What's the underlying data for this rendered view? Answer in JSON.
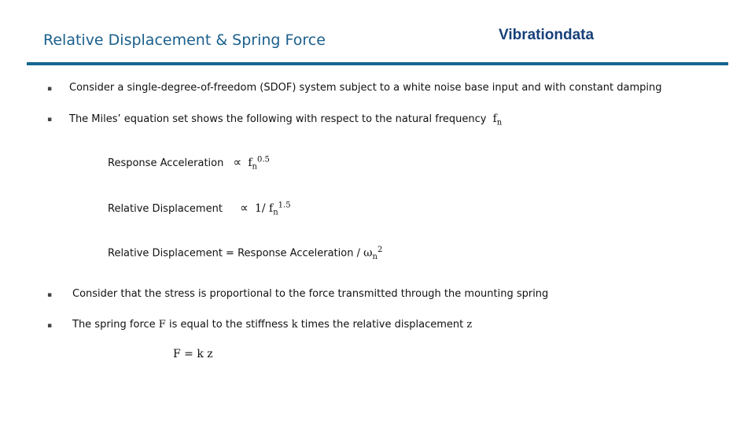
{
  "header": {
    "title": "Relative Displacement & Spring Force",
    "brand": "Vibrationdata"
  },
  "bullets_top": [
    {
      "marker": "▪",
      "text": "Consider a single-degree-of-freedom (SDOF) system subject to a white noise base input and with constant damping"
    },
    {
      "marker": "▪",
      "text": "The Miles’ equation set shows the following with respect to the natural frequency",
      "math": "f",
      "math_sub": "n"
    }
  ],
  "equations": {
    "resp_accel": {
      "label": "Response Acceleration",
      "symbol": "∝",
      "base": "f",
      "sub": "n",
      "sup": "0.5"
    },
    "rel_disp": {
      "label": "Relative Displacement",
      "symbol": "∝",
      "prefix": "1/ f",
      "sub": "n",
      "sup": "1.5"
    },
    "relation": {
      "lhs": "Relative Displacement =",
      "rhs": "Response Acceleration /",
      "base": "ω",
      "sub": "n",
      "sup": "2"
    }
  },
  "bullets_bottom": [
    {
      "marker": "▪",
      "text": "Consider that the stress is proportional to the force transmitted through the mounting spring"
    },
    {
      "marker": "▪",
      "parts": [
        "The spring force ",
        "F",
        " is equal to the stiffness ",
        "k",
        " times the relative displacement ",
        "z"
      ]
    }
  ],
  "formula": "F = k z"
}
